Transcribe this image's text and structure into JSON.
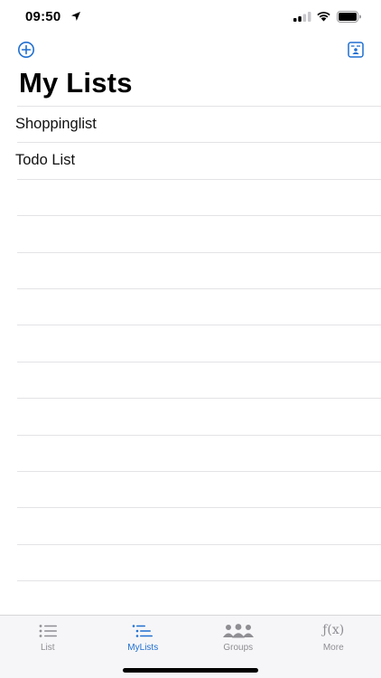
{
  "status_bar": {
    "time": "09:50"
  },
  "nav": {
    "add_icon": "add-circle-icon",
    "contact_icon": "contact-card-icon"
  },
  "title": "My Lists",
  "lists": [
    {
      "name": "Shoppinglist"
    },
    {
      "name": "Todo List"
    }
  ],
  "tabs": [
    {
      "label": "List",
      "icon": "list-icon",
      "active": false
    },
    {
      "label": "MyLists",
      "icon": "mylists-icon",
      "active": true
    },
    {
      "label": "Groups",
      "icon": "groups-icon",
      "active": false
    },
    {
      "label": "More",
      "icon": "function-icon",
      "glyph": "ƒ(x)",
      "active": false
    }
  ],
  "colors": {
    "accent": "#1f6fd1",
    "inactive": "#8e8e93",
    "separator": "#e3e3e6"
  }
}
